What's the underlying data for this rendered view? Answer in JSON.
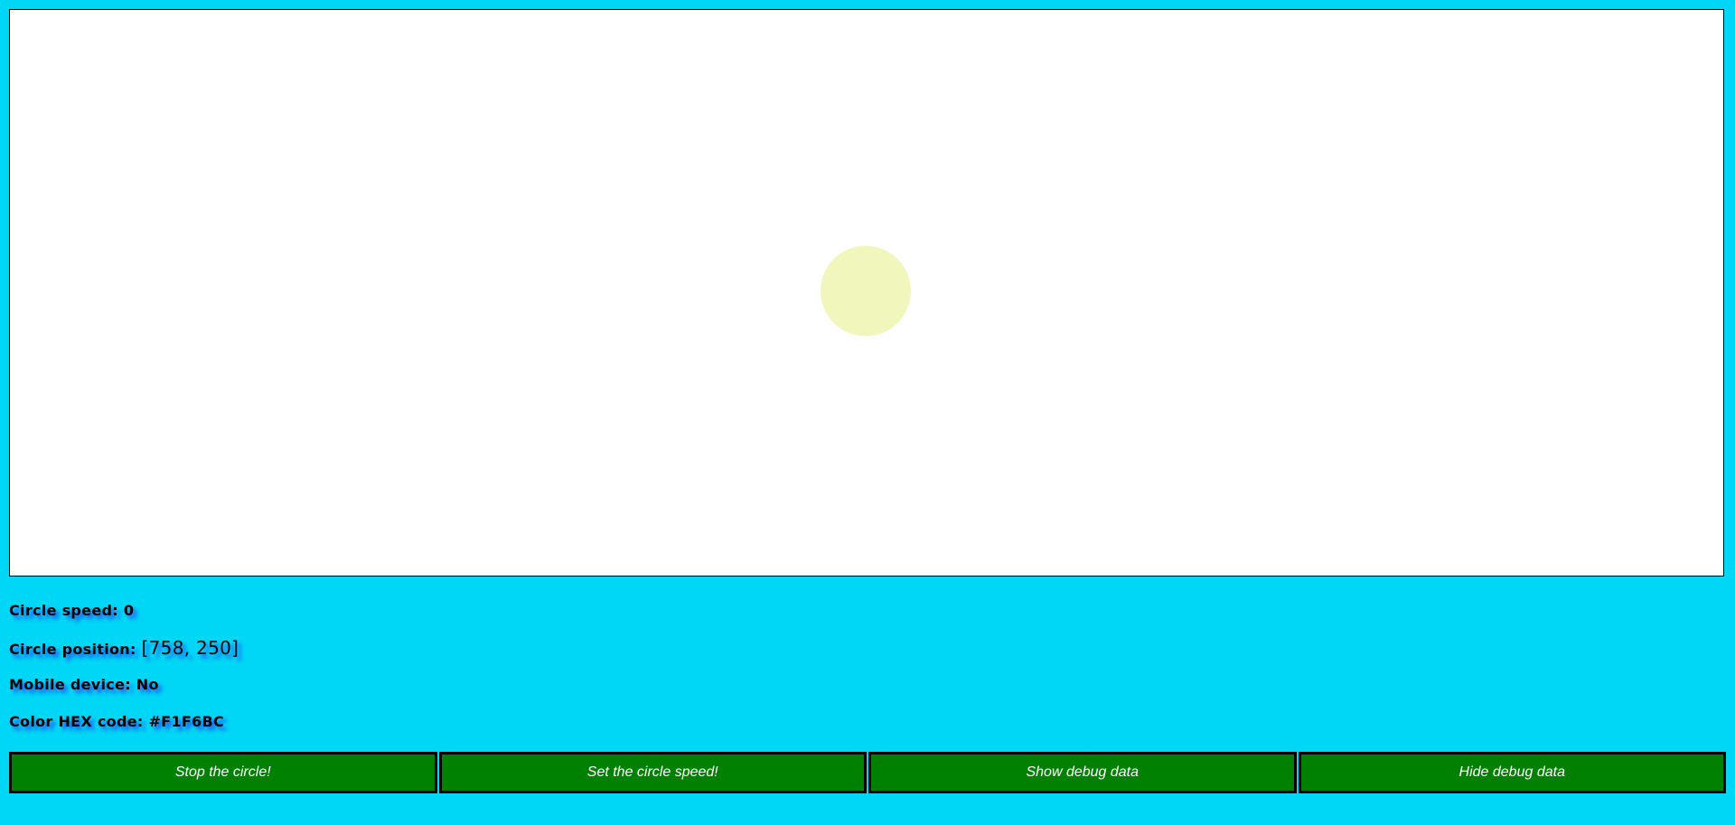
{
  "canvas": {
    "circle_color": "#F1F6BC"
  },
  "debug": {
    "speed_label": "Circle speed: ",
    "speed_value": "0",
    "position_label": "Circle position: ",
    "position_value": "[758, 250]",
    "mobile_label": "Mobile device: ",
    "mobile_value": "No",
    "color_label": "Color HEX code: ",
    "color_value": "#F1F6BC"
  },
  "buttons": {
    "stop_label": "Stop the circle!",
    "set_speed_label": "Set the circle speed!",
    "show_debug_label": "Show debug data",
    "hide_debug_label": "Hide debug data"
  },
  "colors": {
    "background": "#00D6F5",
    "button_bg": "#008000",
    "text_shadow": "#1F56FF"
  }
}
